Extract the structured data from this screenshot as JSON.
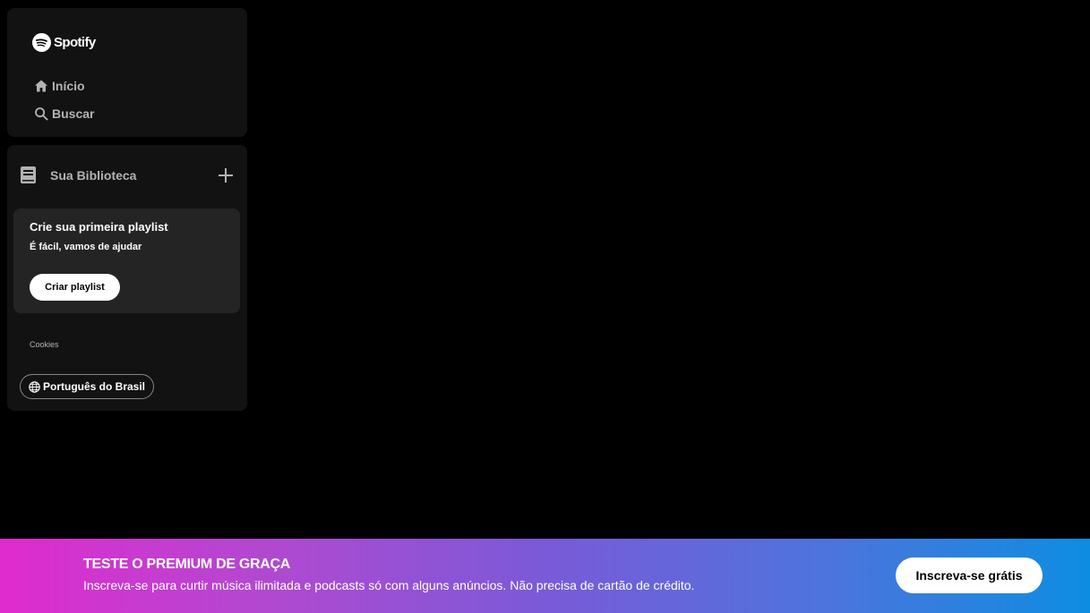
{
  "brand": {
    "name": "Spotify"
  },
  "nav": {
    "home_label": "Início",
    "search_label": "Buscar"
  },
  "library": {
    "title": "Sua Biblioteca",
    "card": {
      "title": "Crie sua primeira playlist",
      "subtitle": "É fácil, vamos de ajudar",
      "button_label": "Criar playlist"
    },
    "cookies_label": "Cookies",
    "language_label": "Português do Brasil"
  },
  "banner": {
    "title": "TESTE O PREMIUM DE GRAÇA",
    "text": "Inscreva-se para curtir música ilimitada e podcasts só com alguns anúncios. Não precisa de cartão de crédito.",
    "button_label": "Inscreva-se grátis"
  },
  "colors": {
    "background": "#000000",
    "panel": "#121212",
    "card": "#242424",
    "muted_text": "#b3b3b3",
    "banner_gradient_start": "#e02bcf",
    "banner_gradient_end": "#0d8de2"
  },
  "icons": [
    "spotify-logo-icon",
    "home-icon",
    "search-icon",
    "library-icon",
    "plus-icon",
    "globe-icon"
  ]
}
